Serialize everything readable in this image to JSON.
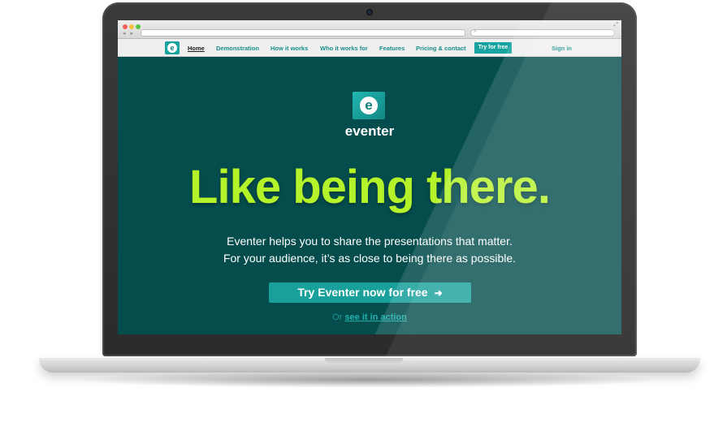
{
  "browser": {
    "window_controls": [
      "close",
      "minimize",
      "zoom"
    ],
    "nav_arrows": "◂ ▸",
    "search_icon": "search-icon",
    "expand_icon": "expand-icon"
  },
  "site_nav": {
    "logo_letter": "e",
    "links": [
      {
        "label": "Home",
        "active": true
      },
      {
        "label": "Demonstration"
      },
      {
        "label": "How it works"
      },
      {
        "label": "Who it works for"
      },
      {
        "label": "Features"
      },
      {
        "label": "Pricing & contact"
      }
    ],
    "cta_label": "Try for free",
    "signin_label": "Sign in"
  },
  "hero": {
    "logo_letter": "e",
    "brand_name": "eventer",
    "headline": "Like being there.",
    "subline_1": "Eventer helps you to share the presentations that matter.",
    "subline_2": "For your audience, it’s as close to being there as possible.",
    "cta_label": "Try Eventer now for free",
    "cta_icon": "arrow-right-icon",
    "or_prefix": "Or",
    "demo_link_label": "see it in action"
  },
  "colors": {
    "background": "#054d4d",
    "accent": "#17a4a0",
    "headline": "#b4f22a",
    "nav_link": "#178e8b"
  }
}
